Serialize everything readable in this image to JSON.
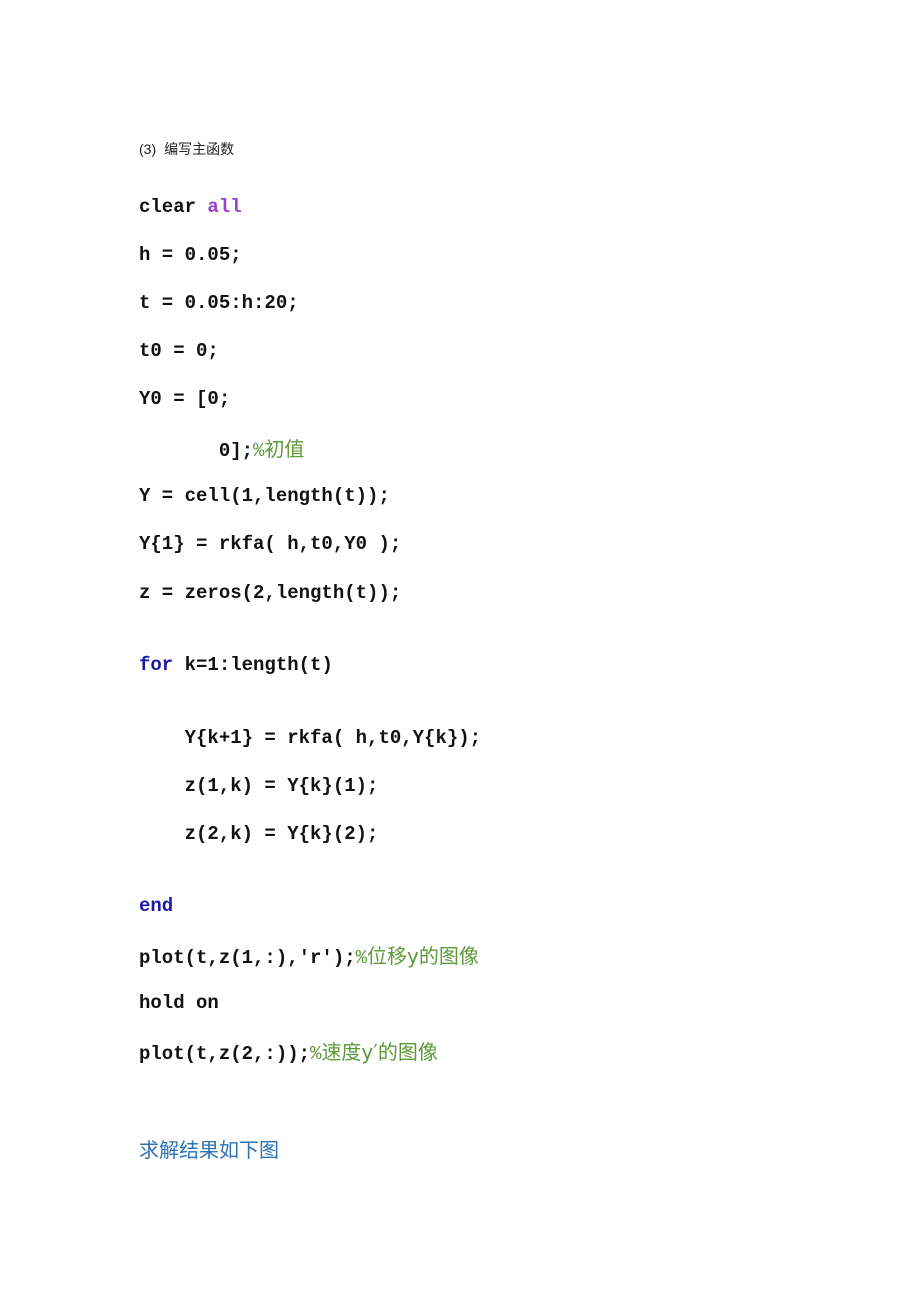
{
  "heading": {
    "number": "(3)",
    "title": "编写主函数"
  },
  "code": {
    "l1": {
      "text": "clear ",
      "keyword_all": "all"
    },
    "l2": "h = 0.05;",
    "l3": "t = 0.05:h:20;",
    "l4": "t0 = 0;",
    "l5": "Y0 = [0;",
    "l6": {
      "code": "       0];",
      "comment_pct": "%",
      "comment": "初值"
    },
    "l7": "Y = cell(1,length(t));",
    "l8": "Y{1} = rkfa( h,t0,Y0 );",
    "l9": "z = zeros(2,length(t));",
    "l10": {
      "keyword": "for",
      "rest": " k=1:length(t)"
    },
    "l11": "    Y{k+1} = rkfa( h,t0,Y{k});",
    "l12": "    z(1,k) = Y{k}(1);",
    "l13": "    z(2,k) = Y{k}(2);",
    "l14": {
      "keyword": "end"
    },
    "l15": {
      "code": "plot(t,z(1,:),'r');",
      "comment_pct": "%",
      "comment": "位移y的图像"
    },
    "l16": "hold on",
    "l17": {
      "code": "plot(t,z(2,:));",
      "comment_pct": "%",
      "comment": "速度y′的图像"
    }
  },
  "result_text": "求解结果如下图",
  "colors": {
    "keyword": "#1a1aa6",
    "string": "#9b3fd0",
    "comment": "#5f9a3a",
    "heading_blue": "#2e74b5"
  }
}
